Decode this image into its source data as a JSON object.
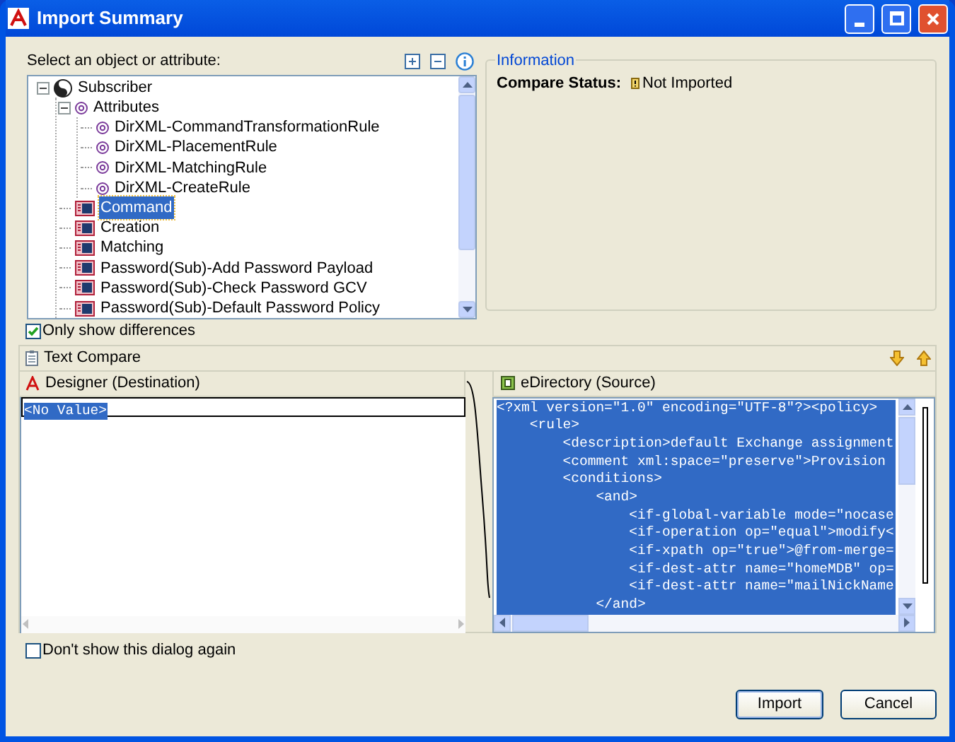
{
  "window": {
    "title": "Import Summary"
  },
  "tree_label": "Select an object or attribute:",
  "tree": [
    {
      "label": "Subscriber",
      "kind": "object",
      "expanded": true,
      "selected": false,
      "children": [
        {
          "label": "Attributes",
          "kind": "attribute-group",
          "expanded": true,
          "selected": false,
          "children": [
            {
              "label": "DirXML-CommandTransformationRule",
              "kind": "attribute",
              "selected": false
            },
            {
              "label": "DirXML-PlacementRule",
              "kind": "attribute",
              "selected": false
            },
            {
              "label": "DirXML-MatchingRule",
              "kind": "attribute",
              "selected": false
            },
            {
              "label": "DirXML-CreateRule",
              "kind": "attribute",
              "selected": false
            }
          ]
        },
        {
          "label": "Command",
          "kind": "policy",
          "selected": true
        },
        {
          "label": "Creation",
          "kind": "policy",
          "selected": false
        },
        {
          "label": "Matching",
          "kind": "policy",
          "selected": false
        },
        {
          "label": "Password(Sub)-Add Password Payload",
          "kind": "policy",
          "selected": false
        },
        {
          "label": "Password(Sub)-Check Password GCV",
          "kind": "policy",
          "selected": false
        },
        {
          "label": "Password(Sub)-Default Password Policy",
          "kind": "policy",
          "selected": false
        }
      ]
    }
  ],
  "information": {
    "title": "Information",
    "status_label": "Compare Status:",
    "status_value": "Not Imported"
  },
  "only_show_differences": {
    "label": "Only show differences",
    "checked": true
  },
  "text_compare": {
    "title": "Text Compare",
    "left": {
      "title": "Designer (Destination)",
      "lines": [
        "<No Value>"
      ]
    },
    "right": {
      "title": "eDirectory (Source)",
      "lines": [
        "<?xml version=\"1.0\" encoding=\"UTF-8\"?><policy>",
        "    <rule>",
        "        <description>default Exchange assignment",
        "        <comment xml:space=\"preserve\">Provision",
        "        <conditions>",
        "            <and>",
        "                <if-global-variable mode=\"nocase",
        "                <if-operation op=\"equal\">modify<",
        "                <if-xpath op=\"true\">@from-merge=",
        "                <if-dest-attr name=\"homeMDB\" op=",
        "                <if-dest-attr name=\"mailNickName",
        "            </and>"
      ]
    }
  },
  "dont_show_again": {
    "label": "Don't show this dialog again",
    "checked": false
  },
  "buttons": [
    {
      "label": "Import",
      "default": true
    },
    {
      "label": "Cancel",
      "default": false
    }
  ]
}
